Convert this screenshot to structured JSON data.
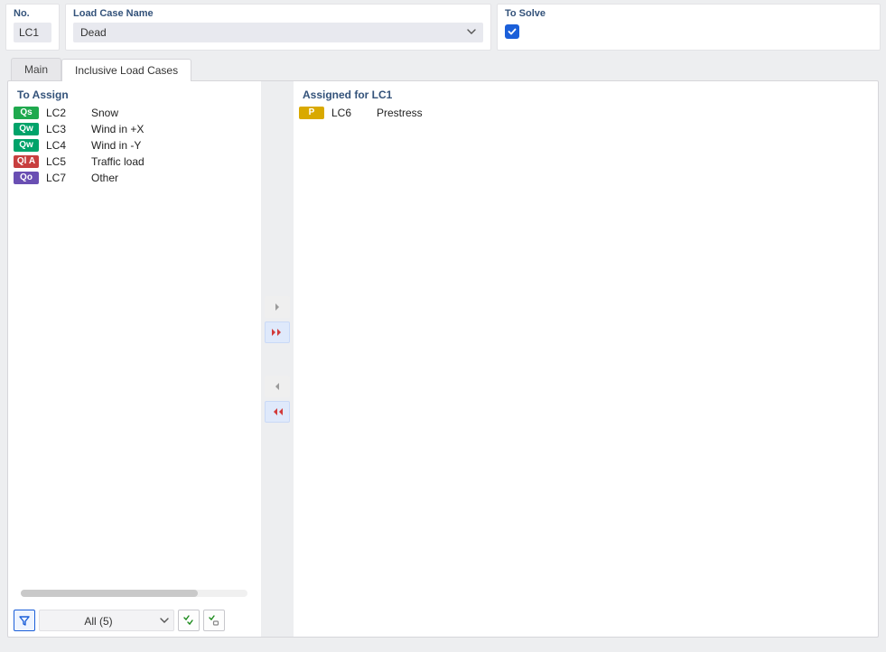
{
  "header": {
    "no_label": "No.",
    "no_value": "LC1",
    "name_label": "Load Case Name",
    "name_value": "Dead",
    "solve_label": "To Solve",
    "solve_checked": true
  },
  "tabs": {
    "main": "Main",
    "inclusive": "Inclusive Load Cases",
    "active": "inclusive"
  },
  "left_panel": {
    "title": "To Assign",
    "items": [
      {
        "badge": "Qs",
        "badge_color": "#1fa94e",
        "id": "LC2",
        "name": "Snow"
      },
      {
        "badge": "Qw",
        "badge_color": "#00a36a",
        "id": "LC3",
        "name": "Wind in +X"
      },
      {
        "badge": "Qw",
        "badge_color": "#00a36a",
        "id": "LC4",
        "name": "Wind in -Y"
      },
      {
        "badge": "Ql A",
        "badge_color": "#c83f3f",
        "id": "LC5",
        "name": "Traffic load"
      },
      {
        "badge": "Qo",
        "badge_color": "#6a4fb3",
        "id": "LC7",
        "name": "Other"
      }
    ],
    "footer": {
      "filter_active": true,
      "all_label": "All (5)"
    }
  },
  "right_panel": {
    "title": "Assigned for LC1",
    "items": [
      {
        "badge": "P",
        "badge_color": "#d9a900",
        "id": "LC6",
        "name": "Prestress"
      }
    ]
  },
  "colors": {
    "header_text": "#33527a",
    "accent": "#1b5fd9"
  }
}
